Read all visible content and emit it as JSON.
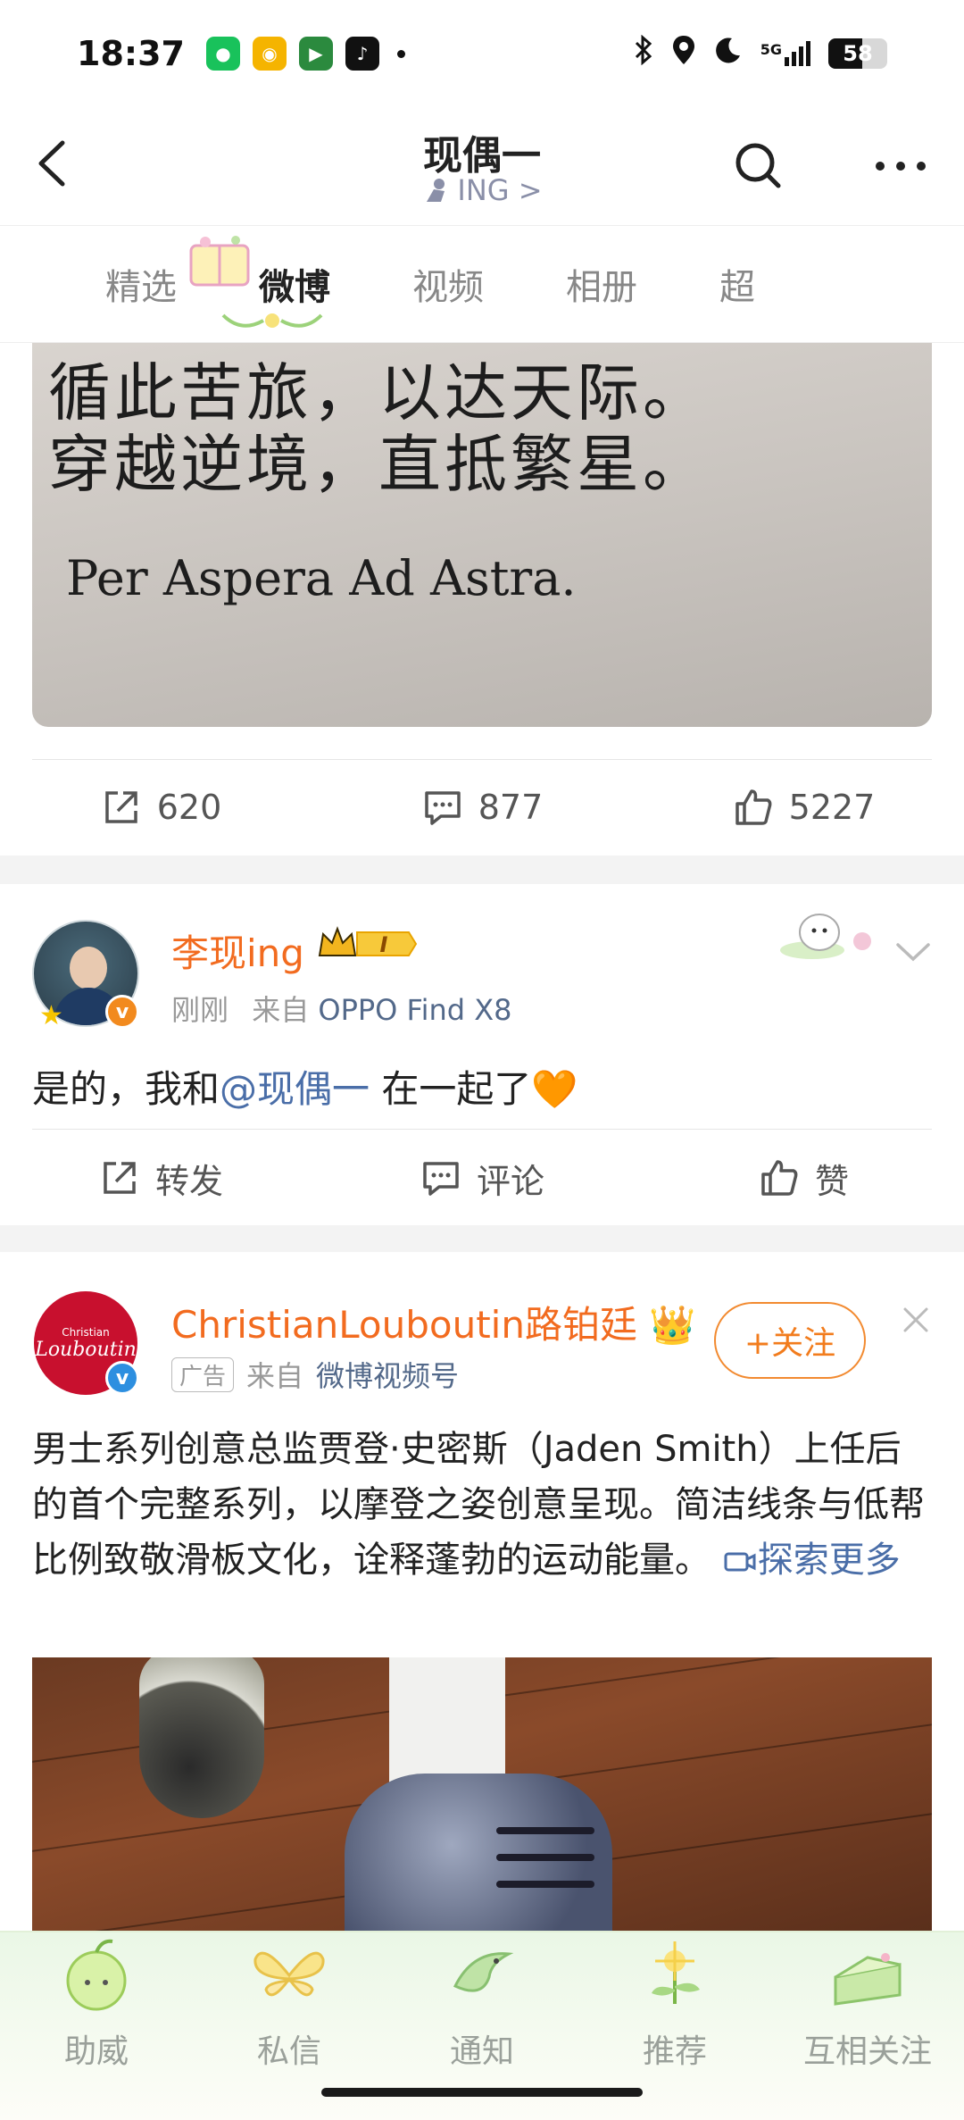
{
  "status_bar": {
    "time": "18:37",
    "network": "5G",
    "battery": "58",
    "battery_level": 0.58,
    "apps": [
      "wechat-icon",
      "weibo-icon",
      "video-app-icon",
      "music-app-icon"
    ]
  },
  "header": {
    "title": "现偶一",
    "subtitle": "ING >"
  },
  "tabs": [
    {
      "label": "精选"
    },
    {
      "label": "微博"
    },
    {
      "label": "视频"
    },
    {
      "label": "相册"
    },
    {
      "label": "超"
    }
  ],
  "post1": {
    "image_lines": [
      "循此苦旅，以达天际。",
      "穿越逆境，直抵繁星。",
      "Per Aspera Ad Astra."
    ],
    "repost_count": "620",
    "comment_count": "877",
    "like_count": "5227"
  },
  "post2": {
    "user_name": "李现ing",
    "vip_badge": "I",
    "time": "刚刚",
    "source_prefix": "来自",
    "source": "OPPO Find X8",
    "text_before": "是的，我和",
    "mention": "@现偶一",
    "text_after": " 在一起了🧡",
    "repost_label": "转发",
    "comment_label": "评论",
    "like_label": "赞"
  },
  "post3": {
    "avatar_top": "Christian",
    "avatar_script": "Louboutin",
    "user_name": "ChristianLouboutin路铂廷 👑",
    "ad_tag": "广告",
    "source_prefix": "来自",
    "source": "微博视频号",
    "follow_label": "+关注",
    "text": "男士系列创意总监贾登·史密斯（Jaden Smith）上任后的首个完整系列，以摩登之姿创意呈现。简洁线条与低帮比例致敬滑板文化，诠释蓬勃的运动能量。",
    "link": "探索更多"
  },
  "bottom_nav": [
    {
      "label": "助威",
      "icon": "apple-icon"
    },
    {
      "label": "私信",
      "icon": "butterfly-icon"
    },
    {
      "label": "通知",
      "icon": "bird-icon"
    },
    {
      "label": "推荐",
      "icon": "flower-icon"
    },
    {
      "label": "互相关注",
      "icon": "cake-icon"
    }
  ],
  "colors": {
    "accent": "#f26b1f",
    "link": "#4a6ea8",
    "ad_brand": "#c8102e"
  }
}
